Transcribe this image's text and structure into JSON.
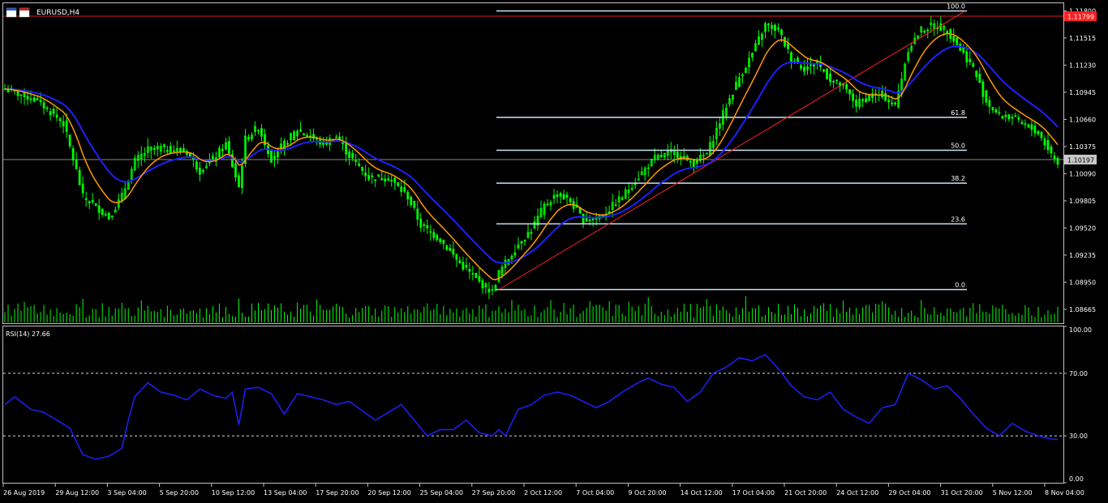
{
  "window": {
    "symbol_title": "EURUSD,H4",
    "icon": "chart-window-icon"
  },
  "colors": {
    "background": "#000000",
    "candles": "#00ff00",
    "volume": "#00ff00",
    "ma_fast": "#ff9900",
    "ma_slow": "#1f1fff",
    "fib": "#c8e4f5",
    "trend": "#ff2020",
    "rsi": "#1f1fff",
    "price_tag": "#ff2020",
    "current_tag": "#c8c8c8"
  },
  "price_axis": {
    "ticks": [
      "1.11800",
      "1.11515",
      "1.11230",
      "1.10945",
      "1.10660",
      "1.10375",
      "1.10090",
      "1.09805",
      "1.09520",
      "1.09235",
      "1.08950",
      "1.08665"
    ],
    "range": [
      1.0852,
      1.1188
    ],
    "top_tag": "1.11799",
    "current_tag": "1.10197"
  },
  "fibonacci": {
    "low": 1.08873,
    "high": 1.11799,
    "levels": [
      {
        "label": "100.0",
        "ratio": 1.0
      },
      {
        "label": "61.8",
        "ratio": 0.618
      },
      {
        "label": "50.0",
        "ratio": 0.5
      },
      {
        "label": "38.2",
        "ratio": 0.382
      },
      {
        "label": "23.6",
        "ratio": 0.236
      },
      {
        "label": "0.0",
        "ratio": 0.0
      }
    ]
  },
  "rsi": {
    "label": "RSI(14) 27.66",
    "range": [
      0,
      100
    ],
    "ticks": [
      "100.00",
      "70.00",
      "30.00",
      "0.00"
    ],
    "levels": [
      70,
      30
    ]
  },
  "time_axis": {
    "labels": [
      "26 Aug 2019",
      "29 Aug 12:00",
      "3 Sep 04:00",
      "5 Sep 20:00",
      "10 Sep 12:00",
      "13 Sep 04:00",
      "17 Sep 20:00",
      "20 Sep 12:00",
      "25 Sep 04:00",
      "27 Sep 20:00",
      "2 Oct 12:00",
      "7 Oct 04:00",
      "9 Oct 20:00",
      "14 Oct 12:00",
      "17 Oct 04:00",
      "21 Oct 20:00",
      "24 Oct 12:00",
      "29 Oct 04:00",
      "31 Oct 20:00",
      "5 Nov 12:00",
      "8 Nov 04:00"
    ]
  },
  "chart_data": {
    "type": "line",
    "description_series": [
      "close",
      "ma_fast",
      "ma_slow",
      "rsi"
    ],
    "anchors": {
      "close": [
        [
          0,
          1.1098
        ],
        [
          10,
          1.1086
        ],
        [
          18,
          1.1062
        ],
        [
          22,
          1.1012
        ],
        [
          24,
          1.0985
        ],
        [
          28,
          1.0975
        ],
        [
          32,
          1.0963
        ],
        [
          36,
          1.0985
        ],
        [
          40,
          1.1022
        ],
        [
          44,
          1.1034
        ],
        [
          48,
          1.1036
        ],
        [
          56,
          1.1032
        ],
        [
          60,
          1.1012
        ],
        [
          64,
          1.1024
        ],
        [
          68,
          1.104
        ],
        [
          72,
          1.0995
        ],
        [
          74,
          1.1045
        ],
        [
          78,
          1.1058
        ],
        [
          82,
          1.1025
        ],
        [
          86,
          1.104
        ],
        [
          90,
          1.1055
        ],
        [
          94,
          1.1048
        ],
        [
          98,
          1.104
        ],
        [
          102,
          1.1048
        ],
        [
          106,
          1.1028
        ],
        [
          112,
          1.1005
        ],
        [
          118,
          1.1005
        ],
        [
          124,
          1.0985
        ],
        [
          128,
          1.0955
        ],
        [
          134,
          1.094
        ],
        [
          140,
          1.0915
        ],
        [
          146,
          1.0895
        ],
        [
          150,
          1.0885
        ],
        [
          152,
          1.0905
        ],
        [
          158,
          1.0935
        ],
        [
          162,
          1.095
        ],
        [
          166,
          1.0975
        ],
        [
          170,
          1.0988
        ],
        [
          174,
          1.098
        ],
        [
          178,
          1.096
        ],
        [
          184,
          1.0965
        ],
        [
          190,
          1.0985
        ],
        [
          196,
          1.101
        ],
        [
          200,
          1.1025
        ],
        [
          206,
          1.1032
        ],
        [
          212,
          1.102
        ],
        [
          216,
          1.103
        ],
        [
          222,
          1.108
        ],
        [
          226,
          1.111
        ],
        [
          230,
          1.1135
        ],
        [
          234,
          1.1165
        ],
        [
          238,
          1.116
        ],
        [
          242,
          1.113
        ],
        [
          246,
          1.112
        ],
        [
          250,
          1.1125
        ],
        [
          254,
          1.1108
        ],
        [
          258,
          1.11
        ],
        [
          262,
          1.1082
        ],
        [
          266,
          1.109
        ],
        [
          270,
          1.1092
        ],
        [
          274,
          1.108
        ],
        [
          278,
          1.114
        ],
        [
          282,
          1.116
        ],
        [
          286,
          1.1165
        ],
        [
          290,
          1.116
        ],
        [
          294,
          1.114
        ],
        [
          298,
          1.112
        ],
        [
          302,
          1.1085
        ],
        [
          306,
          1.107
        ],
        [
          310,
          1.1068
        ],
        [
          314,
          1.106
        ],
        [
          318,
          1.1052
        ],
        [
          322,
          1.103
        ],
        [
          324,
          1.102
        ]
      ],
      "rsi": [
        [
          0,
          50
        ],
        [
          3,
          55
        ],
        [
          8,
          47
        ],
        [
          12,
          45
        ],
        [
          16,
          40
        ],
        [
          20,
          35
        ],
        [
          24,
          18
        ],
        [
          28,
          15
        ],
        [
          32,
          17
        ],
        [
          36,
          22
        ],
        [
          38,
          40
        ],
        [
          40,
          55
        ],
        [
          44,
          64
        ],
        [
          48,
          58
        ],
        [
          52,
          56
        ],
        [
          56,
          53
        ],
        [
          60,
          60
        ],
        [
          64,
          56
        ],
        [
          68,
          54
        ],
        [
          70,
          58
        ],
        [
          72,
          37
        ],
        [
          74,
          60
        ],
        [
          78,
          61
        ],
        [
          82,
          57
        ],
        [
          86,
          44
        ],
        [
          90,
          57
        ],
        [
          94,
          55
        ],
        [
          98,
          53
        ],
        [
          102,
          50
        ],
        [
          106,
          52
        ],
        [
          110,
          46
        ],
        [
          114,
          40
        ],
        [
          118,
          45
        ],
        [
          122,
          50
        ],
        [
          126,
          40
        ],
        [
          130,
          30
        ],
        [
          134,
          34
        ],
        [
          138,
          34
        ],
        [
          142,
          40
        ],
        [
          146,
          32
        ],
        [
          150,
          30
        ],
        [
          152,
          34
        ],
        [
          154,
          30
        ],
        [
          158,
          47
        ],
        [
          162,
          50
        ],
        [
          166,
          56
        ],
        [
          170,
          58
        ],
        [
          174,
          56
        ],
        [
          178,
          52
        ],
        [
          182,
          48
        ],
        [
          186,
          52
        ],
        [
          190,
          58
        ],
        [
          194,
          63
        ],
        [
          198,
          67
        ],
        [
          202,
          63
        ],
        [
          206,
          61
        ],
        [
          210,
          52
        ],
        [
          214,
          58
        ],
        [
          218,
          70
        ],
        [
          222,
          74
        ],
        [
          226,
          80
        ],
        [
          230,
          78
        ],
        [
          234,
          82
        ],
        [
          238,
          73
        ],
        [
          242,
          62
        ],
        [
          246,
          55
        ],
        [
          250,
          53
        ],
        [
          254,
          58
        ],
        [
          258,
          47
        ],
        [
          262,
          42
        ],
        [
          266,
          38
        ],
        [
          270,
          48
        ],
        [
          274,
          50
        ],
        [
          278,
          70
        ],
        [
          282,
          66
        ],
        [
          286,
          60
        ],
        [
          290,
          62
        ],
        [
          294,
          54
        ],
        [
          298,
          44
        ],
        [
          302,
          35
        ],
        [
          306,
          30
        ],
        [
          310,
          38
        ],
        [
          314,
          33
        ],
        [
          318,
          30
        ],
        [
          322,
          28
        ],
        [
          324,
          27.66
        ]
      ]
    },
    "total_bars": 325,
    "x_range": [
      "26 Aug 2019",
      "8 Nov 04:00"
    ],
    "y_range": [
      1.0852,
      1.1188
    ]
  }
}
